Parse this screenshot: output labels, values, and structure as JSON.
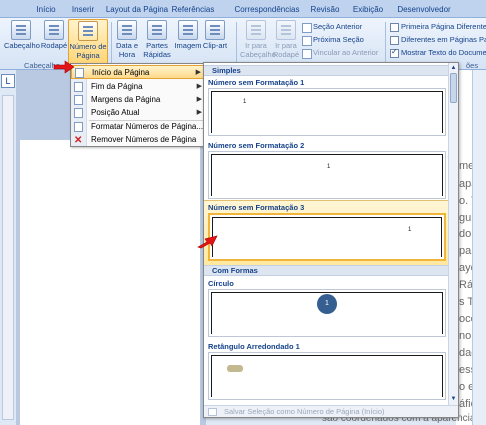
{
  "tabs": [
    "Início",
    "Inserir",
    "Layout da Página",
    "Referências",
    "Correspondências",
    "Revisão",
    "Exibição",
    "Desenvolvedor"
  ],
  "ribbon": {
    "header": "Cabeçalho",
    "footer": "Rodapé",
    "page_number_line1": "Número de",
    "page_number_line2": "Página",
    "date_time_line1": "Data e",
    "date_time_line2": "Hora",
    "quick_parts_line1": "Partes",
    "quick_parts_line2": "Rápidas",
    "picture": "Imagem",
    "clip_art": "Clip-art",
    "goto_header_line1": "Ir para",
    "goto_header_line2": "Cabeçalho",
    "goto_footer_line1": "Ir para",
    "goto_footer_line2": "Rodapé",
    "previous_section": "Seção Anterior",
    "next_section": "Próxima Seção",
    "link_to_previous": "Vincular ao Anterior",
    "different_first_page": "Primeira Página Diferente",
    "different_odd_even": "Diferentes em Páginas Par",
    "show_document_text": "Mostrar Texto do Documen",
    "group_label": "Cabeçalho",
    "group_label_right": "ões"
  },
  "ruler_corner": "L",
  "menu": {
    "items": [
      {
        "label": "Início da Página",
        "arrow": "▶"
      },
      {
        "label": "Fim da Página",
        "arrow": "▶"
      },
      {
        "label": "Margens da Página",
        "arrow": "▶"
      },
      {
        "label": "Posição Atual",
        "arrow": "▶"
      },
      {
        "label": "Formatar Números de Página...",
        "arrow": ""
      },
      {
        "label": "Remover Números de Página",
        "arrow": ""
      }
    ]
  },
  "gallery": {
    "header_simple": "Simples",
    "header_shapes": "Com Formas",
    "item1": "Número sem Formatação 1",
    "item2": "Número sem Formatação 2",
    "item3": "Número sem Formatação 3",
    "item4": "Círculo",
    "item5": "Retângulo Arredondado 1",
    "sample_number": "1",
    "footer": "Salvar Seleção como Número de Página (Início)"
  },
  "document_text": [
    "mente",
    "aparê",
    "o. Voc",
    "guia I",
    "do tem",
    "parênc",
    "ayout",
    "Rápid",
    "s Tem",
    "ocê po",
    "no m",
    "dados",
    "essas",
    "o e ou",
    "áficos",
    "são coordenados com a aparência at"
  ]
}
